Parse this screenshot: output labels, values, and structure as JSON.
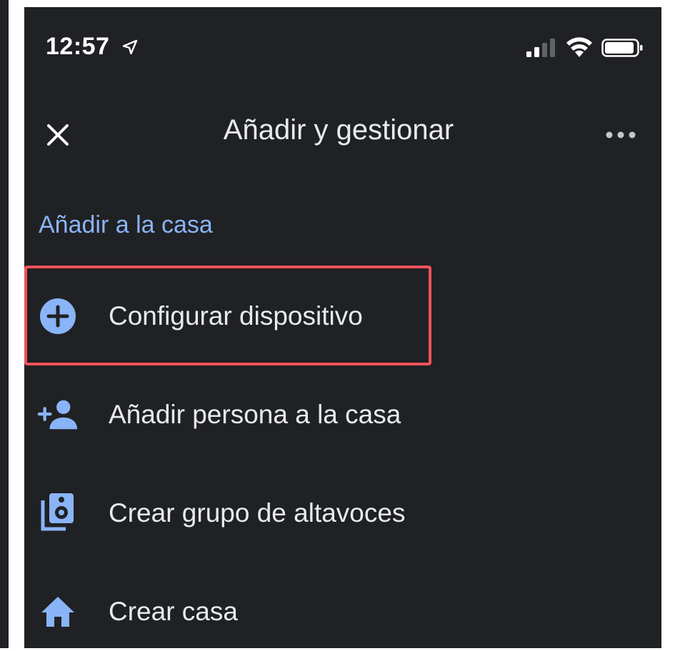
{
  "status_bar": {
    "time": "12:57",
    "icons": [
      "location-arrow-icon",
      "cellular-signal-icon",
      "wifi-icon",
      "battery-icon"
    ]
  },
  "app_bar": {
    "title": "Añadir y gestionar",
    "close_icon": "close-icon",
    "more_icon": "more-horizontal-icon"
  },
  "section": {
    "header": "Añadir a la casa"
  },
  "menu": {
    "items": [
      {
        "label": "Configurar dispositivo",
        "icon": "add-circle-icon",
        "highlighted": true
      },
      {
        "label": "Añadir persona a la casa",
        "icon": "person-add-icon"
      },
      {
        "label": "Crear grupo de altavoces",
        "icon": "speaker-group-icon"
      },
      {
        "label": "Crear casa",
        "icon": "home-icon"
      }
    ]
  },
  "colors": {
    "background": "#202124",
    "accent": "#8ab4f8",
    "text": "#e8eaed",
    "highlight": "#f1525a"
  }
}
